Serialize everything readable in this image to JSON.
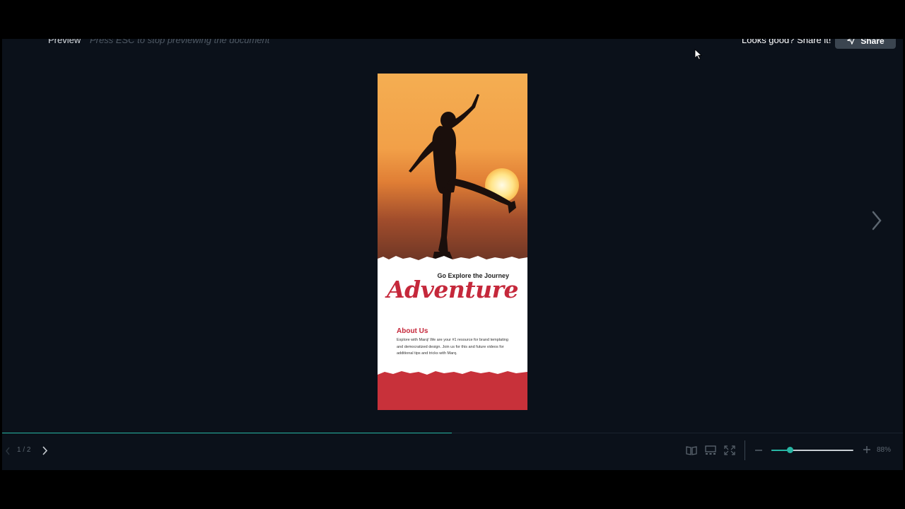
{
  "topbar": {
    "preview_label": "Preview",
    "hint": "Press ESC to stop previewing the document",
    "share_prompt": "Looks good? Share it!",
    "share_button": "Share"
  },
  "document": {
    "subtitle": "Go Explore the Journey",
    "headline": "Adventure",
    "about_title": "About Us",
    "about_body": "Explore with Marq! We are your #1 resource for brand templating and democratized design. Join us for this and future videos for additional tips and tricks with Marq.",
    "colors": {
      "accent": "#c5283b",
      "sky_top": "#f4ae52",
      "sky_bottom": "#6e3625"
    }
  },
  "navigation": {
    "page_indicator": "1 / 2",
    "next_slide_icon": "chevron-right-icon"
  },
  "toolbar": {
    "icons": [
      "book-icon",
      "grid-icon",
      "fullscreen-icon"
    ],
    "zoom_out_icon": "minus-icon",
    "zoom_in_icon": "plus-icon",
    "zoom_level": "88%",
    "zoom_slider_value": 0.22
  },
  "progress": {
    "fraction": 0.5
  },
  "colors": {
    "background": "#0b111a",
    "accent": "#27b6a4"
  }
}
